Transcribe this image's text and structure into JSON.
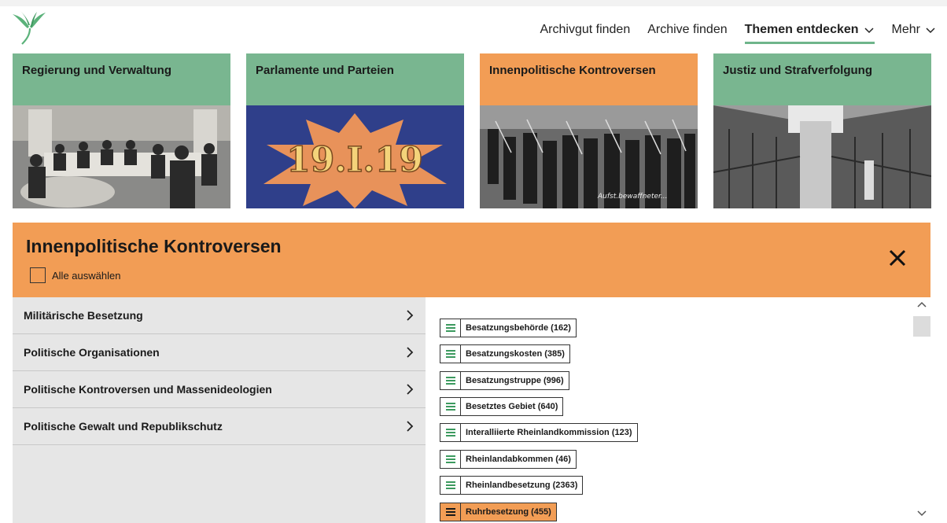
{
  "nav": {
    "items": [
      {
        "label": "Archivgut finden",
        "active": false,
        "dropdown": false
      },
      {
        "label": "Archive finden",
        "active": false,
        "dropdown": false
      },
      {
        "label": "Themen entdecken",
        "active": true,
        "dropdown": true
      },
      {
        "label": "Mehr",
        "active": false,
        "dropdown": true
      }
    ]
  },
  "tiles": [
    {
      "title": "Regierung und Verwaltung",
      "color": "#79b690"
    },
    {
      "title": "Parlamente und Parteien",
      "color": "#79b690",
      "image_text": "19.I.19"
    },
    {
      "title": "Innenpolitische Kontroversen",
      "color": "#f29d55"
    },
    {
      "title": "Justiz und Strafverfolgung",
      "color": "#79b690"
    }
  ],
  "panel": {
    "title": "Innenpolitische Kontroversen",
    "select_all_label": "Alle auswählen"
  },
  "categories": [
    {
      "label": "Militärische Besetzung"
    },
    {
      "label": "Politische Organisationen"
    },
    {
      "label": "Politische Kontroversen und Massenideologien"
    },
    {
      "label": "Politische Gewalt und Republikschutz"
    }
  ],
  "tags": [
    {
      "label": "Besatzungsbehörde (162)",
      "selected": false
    },
    {
      "label": "Besatzungskosten (385)",
      "selected": false
    },
    {
      "label": "Besatzungstruppe (996)",
      "selected": false
    },
    {
      "label": "Besetztes Gebiet (640)",
      "selected": false
    },
    {
      "label": "Interalliierte Rheinlandkommission (123)",
      "selected": false
    },
    {
      "label": "Rheinlandabkommen (46)",
      "selected": false
    },
    {
      "label": "Rheinlandbesetzung (2363)",
      "selected": false
    },
    {
      "label": "Ruhrbesetzung (455)",
      "selected": true
    }
  ],
  "colors": {
    "accent_green": "#79b690",
    "accent_orange": "#f29d55",
    "list_icon": "#3c9a5f"
  },
  "icons": {
    "logo": "bird-logo-icon",
    "dropdown": "chevron-down-icon",
    "close": "close-icon",
    "category_arrow": "chevron-right-icon",
    "tag": "list-icon"
  }
}
